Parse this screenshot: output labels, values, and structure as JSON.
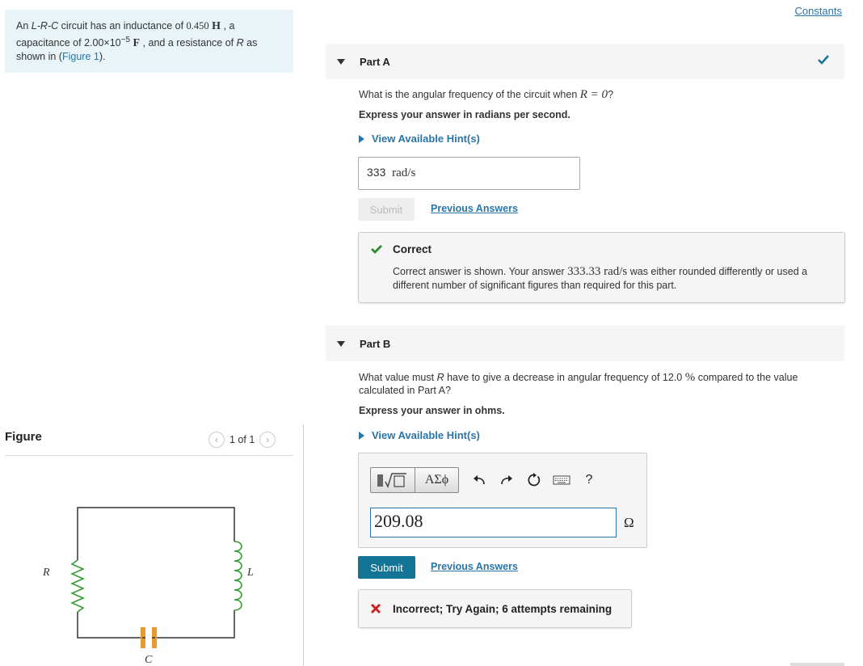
{
  "problem": {
    "text_1": "An ",
    "circuit_type": "L-R-C",
    "text_2": " circuit has an inductance of ",
    "inductance_value": "0.450",
    "inductance_unit": "H",
    "text_3": " , a capacitance of ",
    "capacitance_mantissa": "2.00×10",
    "capacitance_exponent": "−5",
    "capacitance_unit": "F",
    "text_4": " , and a resistance of ",
    "resistance_symbol": "R",
    "text_5": " as shown in (",
    "figure_link": "Figure 1",
    "text_6": ")."
  },
  "figure": {
    "title": "Figure",
    "pager": "1 of 1",
    "labels": {
      "resistor": "R",
      "inductor": "L",
      "capacitor": "C"
    }
  },
  "header": {
    "constants_link": "Constants"
  },
  "part_a": {
    "title": "Part A",
    "question_pre": "What is the angular frequency of the circuit when ",
    "question_math": "R = 0",
    "question_post": "?",
    "instruction": "Express your answer in radians per second.",
    "hint_link": "View Available Hint(s)",
    "answer_value": "333",
    "answer_unit": "rad/s",
    "submit_label": "Submit",
    "previous_answers_label": "Previous Answers",
    "feedback": {
      "heading": "Correct",
      "body_pre": "Correct answer is shown. Your answer ",
      "body_value": "333.33 rad/s",
      "body_post": " was either rounded differently or used a different number of significant figures than required for this part."
    },
    "status_colors": {
      "correct": "#2e8b2e"
    }
  },
  "part_b": {
    "title": "Part B",
    "question_pre": "What value must ",
    "question_symbol": "R",
    "question_mid": " have to give a decrease in angular frequency of 12.0 ",
    "question_percent": "%",
    "question_post": " compared to the value calculated in Part A?",
    "instruction": "Express your answer in ohms.",
    "hint_link": "View Available Hint(s)",
    "toolbar": {
      "symbols_label": "ΑΣϕ",
      "help_label": "?"
    },
    "answer_value": "209.08",
    "answer_unit": "Ω",
    "submit_label": "Submit",
    "previous_answers_label": "Previous Answers",
    "feedback": {
      "heading": "Incorrect; Try Again; 6 attempts remaining"
    },
    "status_colors": {
      "incorrect": "#cc2222",
      "submit_bg": "#147496"
    }
  }
}
